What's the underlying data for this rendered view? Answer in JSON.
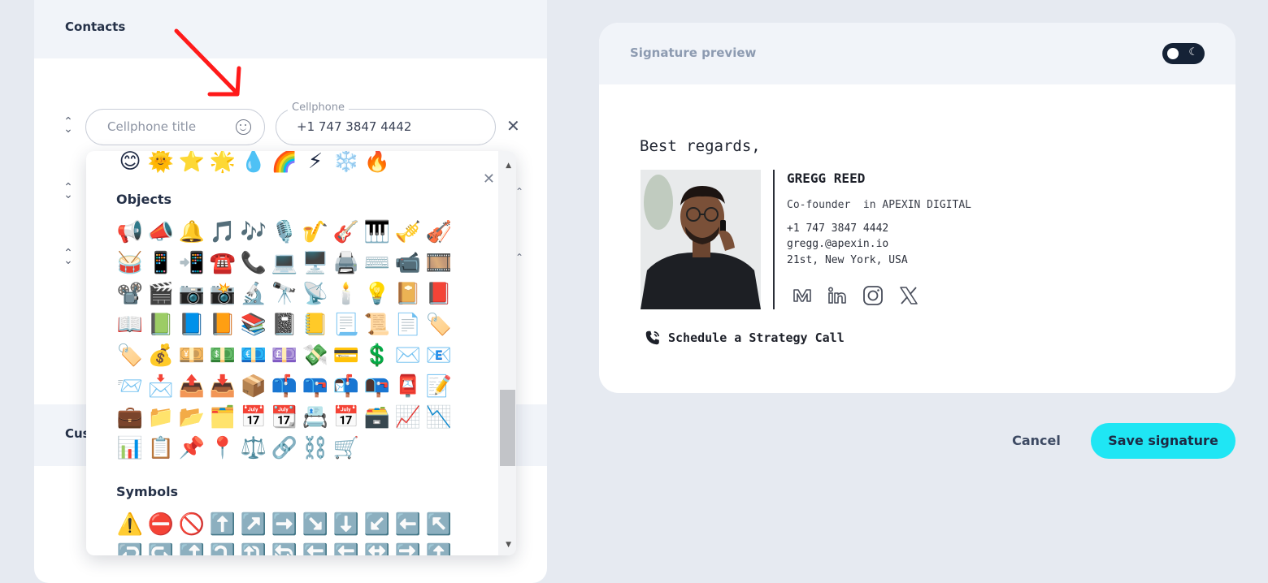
{
  "left_panel": {
    "section_title": "Contacts",
    "section2_title_partial": "Cus",
    "cellphone_title_placeholder": "Cellphone title",
    "cellphone_label": "Cellphone",
    "cellphone_value": "+1 747 3847 4442",
    "close_symbol": "✕"
  },
  "emoji_picker": {
    "close_symbol": "✕",
    "top_partial_row": [
      "😊",
      "🌞",
      "⭐",
      "🌟",
      "💧",
      "🌈",
      "⚡",
      "❄️",
      "🔥"
    ],
    "categories": [
      {
        "name": "Objects",
        "rows": [
          [
            "📢",
            "📣",
            "🔔",
            "🎵",
            "🎶",
            "🎙️",
            "🎷",
            "🎸",
            "🎹",
            "🎺",
            "🎻"
          ],
          [
            "🥁",
            "📱",
            "📲",
            "☎️",
            "📞",
            "💻",
            "🖥️",
            "🖨️",
            "⌨️",
            "📹",
            "🎞️"
          ],
          [
            "📽️",
            "🎬",
            "📷",
            "📸",
            "🔬",
            "🔭",
            "📡",
            "🕯️",
            "💡",
            "📔",
            "📕"
          ],
          [
            "📖",
            "📗",
            "📘",
            "📙",
            "📚",
            "📓",
            "📒",
            "📃",
            "📜",
            "📄",
            "🏷️"
          ],
          [
            "🏷️",
            "💰",
            "💴",
            "💵",
            "💶",
            "💷",
            "💸",
            "💳",
            "💲",
            "✉️",
            "📧"
          ],
          [
            "📨",
            "📩",
            "📤",
            "📥",
            "📦",
            "📫",
            "📪",
            "📬",
            "📭",
            "📮",
            "📝"
          ],
          [
            "💼",
            "📁",
            "📂",
            "🗂️",
            "📅",
            "📆",
            "📇",
            "📅",
            "🗃️",
            "📈",
            "📉"
          ],
          [
            "📊",
            "📋",
            "📌",
            "📍",
            "⚖️",
            "🔗",
            "⛓️",
            "🛒"
          ]
        ]
      },
      {
        "name": "Symbols",
        "rows": [
          [
            "⚠️",
            "⛔",
            "🚫",
            "⬆️",
            "↗️",
            "➡️",
            "↘️",
            "⬇️",
            "↙️",
            "⬅️",
            "↖️"
          ],
          [
            "↩️",
            "↪️",
            "⤴️",
            "⤵️",
            "🔃",
            "🔄",
            "🔙",
            "🔚",
            "🔛",
            "🔜",
            "🔝"
          ]
        ]
      }
    ]
  },
  "preview": {
    "title": "Signature preview",
    "greeting": "Best regards,",
    "name": "GREGG REED",
    "role": "Co-founder  in APEXIN DIGITAL",
    "phone": "+1 747 3847 4442",
    "email": "gregg.@apexin.io",
    "address": "21st, New York, USA",
    "socials": [
      "medium-icon",
      "linkedin-icon",
      "instagram-icon",
      "x-icon"
    ],
    "cta_text": "Schedule a Strategy Call"
  },
  "actions": {
    "cancel_label": "Cancel",
    "save_label": "Save signature"
  },
  "colors": {
    "accent": "#1fe6f4",
    "annotation_arrow": "#ff1a1a",
    "toggle_bg": "#152236"
  }
}
